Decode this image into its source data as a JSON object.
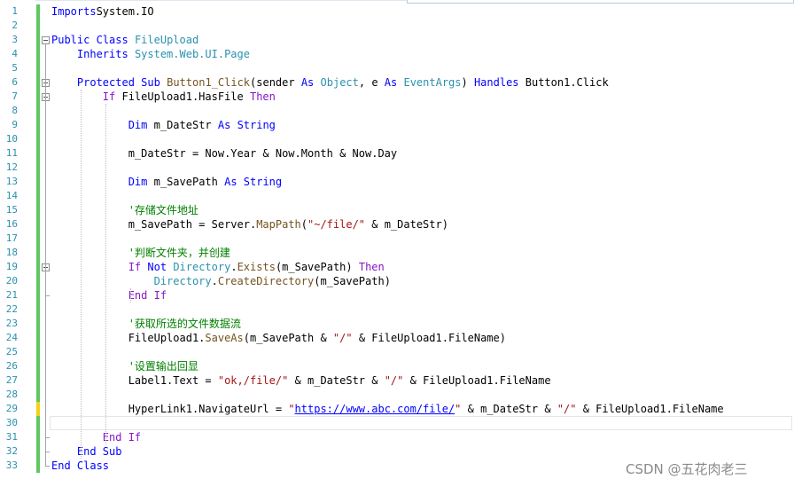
{
  "editor": {
    "language": "Visual Basic",
    "colors": {
      "keyword": "#0000ff",
      "control_keyword": "#8515c8",
      "type": "#2b91af",
      "method": "#74531f",
      "string": "#a31515",
      "comment": "#008000",
      "line_number": "#2b91af",
      "change_saved": "#5ec85e",
      "change_unsaved": "#f2d01a"
    },
    "lines": [
      {
        "n": "1",
        "change": "saved",
        "fold": "",
        "segs": [
          [
            "kw",
            "Imports"
          ],
          [
            "",
            "System.IO"
          ]
        ]
      },
      {
        "n": "2",
        "change": "saved",
        "fold": "",
        "segs": []
      },
      {
        "n": "3",
        "change": "saved",
        "fold": "open",
        "segs": [
          [
            "kw",
            "Public"
          ],
          [
            "",
            " "
          ],
          [
            "kw",
            "Class"
          ],
          [
            "",
            " "
          ],
          [
            "ty",
            "FileUpload"
          ]
        ]
      },
      {
        "n": "4",
        "change": "saved",
        "fold": "",
        "segs": [
          [
            "",
            "    "
          ],
          [
            "kw",
            "Inherits"
          ],
          [
            "",
            " "
          ],
          [
            "ty",
            "System.Web.UI.Page"
          ]
        ]
      },
      {
        "n": "5",
        "change": "saved",
        "fold": "",
        "segs": []
      },
      {
        "n": "6",
        "change": "saved",
        "fold": "open",
        "segs": [
          [
            "",
            "    "
          ],
          [
            "kw",
            "Protected"
          ],
          [
            "",
            " "
          ],
          [
            "kw",
            "Sub"
          ],
          [
            "",
            " "
          ],
          [
            "fn",
            "Button1_Click"
          ],
          [
            "",
            "("
          ],
          [
            "",
            "sender "
          ],
          [
            "kw",
            "As"
          ],
          [
            "",
            " "
          ],
          [
            "ty",
            "Object"
          ],
          [
            "",
            ", e "
          ],
          [
            "kw",
            "As"
          ],
          [
            "",
            " "
          ],
          [
            "ty",
            "EventArgs"
          ],
          [
            "",
            ") "
          ],
          [
            "kw",
            "Handles"
          ],
          [
            "",
            " Button1.Click"
          ]
        ]
      },
      {
        "n": "7",
        "change": "saved",
        "fold": "open",
        "segs": [
          [
            "",
            "        "
          ],
          [
            "kw2",
            "If"
          ],
          [
            "",
            " FileUpload1.HasFile "
          ],
          [
            "kw2",
            "Then"
          ]
        ]
      },
      {
        "n": "8",
        "change": "saved",
        "fold": "",
        "segs": []
      },
      {
        "n": "9",
        "change": "saved",
        "fold": "",
        "segs": [
          [
            "",
            "            "
          ],
          [
            "kw",
            "Dim"
          ],
          [
            "",
            " m_DateStr "
          ],
          [
            "kw",
            "As"
          ],
          [
            "",
            " "
          ],
          [
            "kw",
            "String"
          ]
        ]
      },
      {
        "n": "10",
        "change": "saved",
        "fold": "",
        "segs": []
      },
      {
        "n": "11",
        "change": "saved",
        "fold": "",
        "segs": [
          [
            "",
            "            m_DateStr = Now.Year & Now.Month & Now.Day"
          ]
        ]
      },
      {
        "n": "12",
        "change": "saved",
        "fold": "",
        "segs": []
      },
      {
        "n": "13",
        "change": "saved",
        "fold": "",
        "segs": [
          [
            "",
            "            "
          ],
          [
            "kw",
            "Dim"
          ],
          [
            "",
            " m_SavePath "
          ],
          [
            "kw",
            "As"
          ],
          [
            "",
            " "
          ],
          [
            "kw",
            "String"
          ]
        ]
      },
      {
        "n": "14",
        "change": "saved",
        "fold": "",
        "segs": []
      },
      {
        "n": "15",
        "change": "saved",
        "fold": "",
        "segs": [
          [
            "",
            "            "
          ],
          [
            "cm",
            "'存储文件地址"
          ]
        ]
      },
      {
        "n": "16",
        "change": "saved",
        "fold": "",
        "segs": [
          [
            "",
            "            m_SavePath = Server."
          ],
          [
            "fn",
            "MapPath"
          ],
          [
            "",
            "("
          ],
          [
            "st",
            "\"~/file/\""
          ],
          [
            "",
            " & m_DateStr)"
          ]
        ]
      },
      {
        "n": "17",
        "change": "saved",
        "fold": "",
        "segs": []
      },
      {
        "n": "18",
        "change": "saved",
        "fold": "",
        "segs": [
          [
            "",
            "            "
          ],
          [
            "cm",
            "'判断文件夹，并创建"
          ]
        ]
      },
      {
        "n": "19",
        "change": "saved",
        "fold": "open",
        "segs": [
          [
            "",
            "            "
          ],
          [
            "kw2",
            "If"
          ],
          [
            "",
            " "
          ],
          [
            "kw",
            "Not"
          ],
          [
            "",
            " "
          ],
          [
            "ty",
            "Directory"
          ],
          [
            "",
            "."
          ],
          [
            "fn",
            "Exists"
          ],
          [
            "",
            "(m_SavePath) "
          ],
          [
            "kw2",
            "Then"
          ]
        ]
      },
      {
        "n": "20",
        "change": "saved",
        "fold": "",
        "segs": [
          [
            "",
            "                "
          ],
          [
            "ty",
            "Directory"
          ],
          [
            "",
            "."
          ],
          [
            "fn",
            "CreateDirectory"
          ],
          [
            "",
            "(m_SavePath)"
          ]
        ]
      },
      {
        "n": "21",
        "change": "saved",
        "fold": "end",
        "segs": [
          [
            "",
            "            "
          ],
          [
            "kw2",
            "End If"
          ]
        ]
      },
      {
        "n": "22",
        "change": "saved",
        "fold": "",
        "segs": []
      },
      {
        "n": "23",
        "change": "saved",
        "fold": "",
        "segs": [
          [
            "",
            "            "
          ],
          [
            "cm",
            "'获取所选的文件数据流"
          ]
        ]
      },
      {
        "n": "24",
        "change": "saved",
        "fold": "",
        "segs": [
          [
            "",
            "            FileUpload1."
          ],
          [
            "fn",
            "SaveAs"
          ],
          [
            "",
            "(m_SavePath & "
          ],
          [
            "st",
            "\"/\""
          ],
          [
            "",
            " & FileUpload1.FileName)"
          ]
        ]
      },
      {
        "n": "25",
        "change": "saved",
        "fold": "",
        "segs": []
      },
      {
        "n": "26",
        "change": "saved",
        "fold": "",
        "segs": [
          [
            "",
            "            "
          ],
          [
            "cm",
            "'设置输出回显"
          ]
        ]
      },
      {
        "n": "27",
        "change": "saved",
        "fold": "",
        "segs": [
          [
            "",
            "            Label1.Text = "
          ],
          [
            "st",
            "\"ok,/file/\""
          ],
          [
            "",
            " & m_DateStr & "
          ],
          [
            "st",
            "\"/\""
          ],
          [
            "",
            " & FileUpload1.FileName"
          ]
        ]
      },
      {
        "n": "28",
        "change": "saved",
        "fold": "",
        "segs": []
      },
      {
        "n": "29",
        "change": "unsaved",
        "fold": "",
        "segs": [
          [
            "",
            "            HyperLink1.NavigateUrl = "
          ],
          [
            "st",
            "\""
          ],
          [
            "url",
            "https://www.abc.com/file/"
          ],
          [
            "st",
            "\""
          ],
          [
            "",
            " & m_DateStr & "
          ],
          [
            "st",
            "\"/\""
          ],
          [
            "",
            " & FileUpload1.FileName"
          ]
        ]
      },
      {
        "n": "30",
        "change": "saved",
        "fold": "",
        "cursor": true,
        "segs": []
      },
      {
        "n": "31",
        "change": "saved",
        "fold": "end",
        "segs": [
          [
            "",
            "        "
          ],
          [
            "kw2",
            "End If"
          ]
        ]
      },
      {
        "n": "32",
        "change": "saved",
        "fold": "end",
        "segs": [
          [
            "",
            "    "
          ],
          [
            "kw",
            "End Sub"
          ]
        ]
      },
      {
        "n": "33",
        "change": "saved",
        "fold": "end",
        "segs": [
          [
            "kw",
            "End Class"
          ]
        ]
      }
    ]
  },
  "watermark": "CSDN @五花肉老三"
}
